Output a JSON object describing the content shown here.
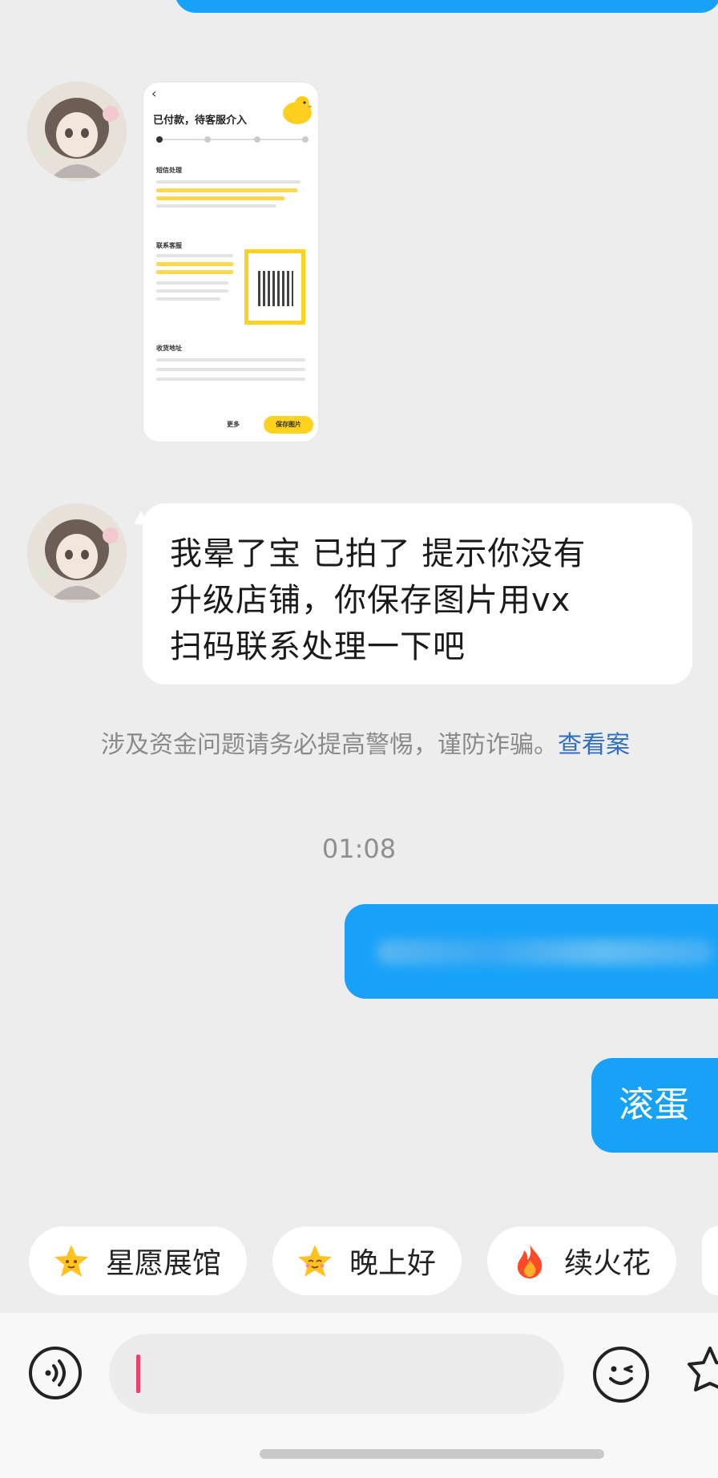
{
  "image_message": {
    "status_title": "已付款，待客服介入",
    "save_button": "保存图片",
    "more_button": "更多",
    "section_risk": "短信处理",
    "section_contact": "联系客服",
    "section_address": "收货地址"
  },
  "incoming_message": {
    "line1": "我晕了宝 已拍了 提示你没有",
    "line2": "升级店铺，你保存图片用vx",
    "line3": "扫码联系处理一下吧"
  },
  "warning": {
    "text": "涉及资金问题请务必提高警惕，谨防诈骗。",
    "link": "查看案"
  },
  "timestamp": "01:08",
  "outgoing_message": "滚蛋",
  "quick_replies": [
    {
      "label": "星愿展馆",
      "icon": "star-face-icon"
    },
    {
      "label": "晚上好",
      "icon": "star-face-icon"
    },
    {
      "label": "续火花",
      "icon": "fire-icon"
    }
  ],
  "colors": {
    "outgoing_bubble": "#17a2f8",
    "background": "#ededed",
    "link": "#2f6fc2",
    "caret": "#ef3f6b"
  }
}
